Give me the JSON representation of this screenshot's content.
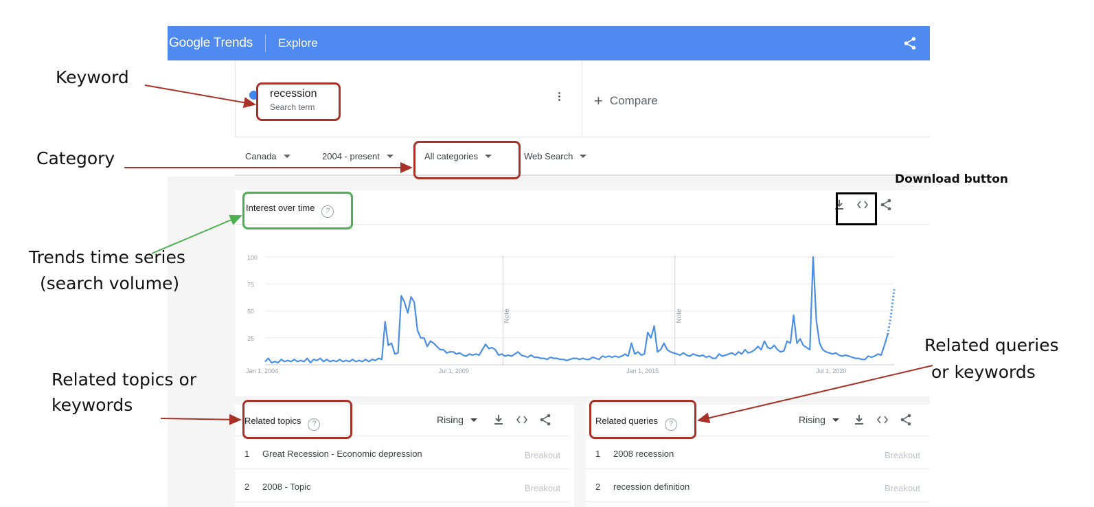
{
  "header": {
    "logo_text": "Google Trends",
    "title": "Explore",
    "share_icon": "share-icon",
    "color": "#4f8af0"
  },
  "search": {
    "term": "recession",
    "term_type": "Search term",
    "term_color": "#4285f4",
    "compare_label": "Compare"
  },
  "filters": {
    "region": "Canada",
    "time_range": "2004 - present",
    "category": "All categories",
    "search_type": "Web Search"
  },
  "interest_over_time": {
    "title": "Interest over time",
    "icons": [
      "download-icon",
      "embed-icon",
      "share-icon"
    ]
  },
  "chart_data": {
    "type": "line",
    "series": [
      {
        "values": [
          3,
          6,
          2,
          3,
          2,
          5,
          3,
          4,
          3,
          5,
          3,
          4,
          3,
          6,
          2,
          5,
          4,
          6,
          3,
          5,
          3,
          4,
          3,
          5,
          3,
          4,
          3,
          5,
          3,
          4,
          3,
          5,
          3,
          5,
          4,
          6,
          5,
          40,
          18,
          20,
          10,
          11,
          64,
          58,
          48,
          63,
          58,
          32,
          25,
          25,
          17,
          22,
          20,
          17,
          14,
          14,
          11,
          12,
          12,
          10,
          11,
          9,
          8,
          10,
          9,
          10,
          9,
          14,
          19,
          15,
          16,
          14,
          9,
          10,
          8,
          9,
          8,
          10,
          12,
          9,
          8,
          7,
          9,
          7,
          7,
          6,
          6,
          5,
          7,
          6,
          6,
          5,
          5,
          4,
          5,
          6,
          6,
          5,
          6,
          5,
          5,
          7,
          6,
          5,
          8,
          7,
          8,
          7,
          8,
          7,
          8,
          10,
          8,
          20,
          10,
          12,
          9,
          10,
          30,
          25,
          36,
          12,
          14,
          20,
          14,
          12,
          11,
          10,
          9,
          11,
          9,
          8,
          10,
          9,
          8,
          9,
          7,
          8,
          6,
          6,
          10,
          8,
          9,
          10,
          11,
          9,
          12,
          10,
          14,
          11,
          12,
          14,
          17,
          14,
          22,
          16,
          15,
          18,
          14,
          12,
          13,
          22,
          20,
          46,
          20,
          24,
          18,
          16,
          14,
          100,
          41,
          20,
          14,
          12,
          11,
          10,
          11,
          9,
          8,
          9,
          8,
          7,
          6,
          6,
          5,
          5,
          8,
          7,
          8,
          10,
          9,
          18,
          28,
          45,
          70
        ],
        "projected_tail_count": 2,
        "color": "#4a8fe7"
      }
    ],
    "x_tick_labels": [
      "Jan 1, 2004",
      "Jul 1, 2009",
      "Jan 1, 2015",
      "Jul 1, 2020"
    ],
    "y_ticks": [
      25,
      50,
      75,
      100
    ],
    "ylim": [
      0,
      100
    ],
    "notes": [
      "Note",
      "Note"
    ],
    "grid": true
  },
  "related_topics": {
    "title": "Related topics",
    "sort": "Rising",
    "rows": [
      {
        "rank": "1",
        "label": "Great Recession - Economic depression",
        "value": "Breakout"
      },
      {
        "rank": "2",
        "label": "2008 - Topic",
        "value": "Breakout"
      }
    ]
  },
  "related_queries": {
    "title": "Related queries",
    "sort": "Rising",
    "rows": [
      {
        "rank": "1",
        "label": "2008 recession",
        "value": "Breakout"
      },
      {
        "rank": "2",
        "label": "recession definition",
        "value": "Breakout"
      }
    ]
  },
  "annotations": {
    "keyword": "Keyword",
    "category": "Category",
    "time_series_line1": "Trends time series",
    "time_series_line2": "(search volume)",
    "related_topics_line1": "Related topics or",
    "related_topics_line2": "keywords",
    "related_queries_line1": "Related queries",
    "related_queries_line2": "or keywords",
    "download_button": "Download button",
    "arrow_color": "#a83228",
    "green_color": "#4caf50"
  }
}
